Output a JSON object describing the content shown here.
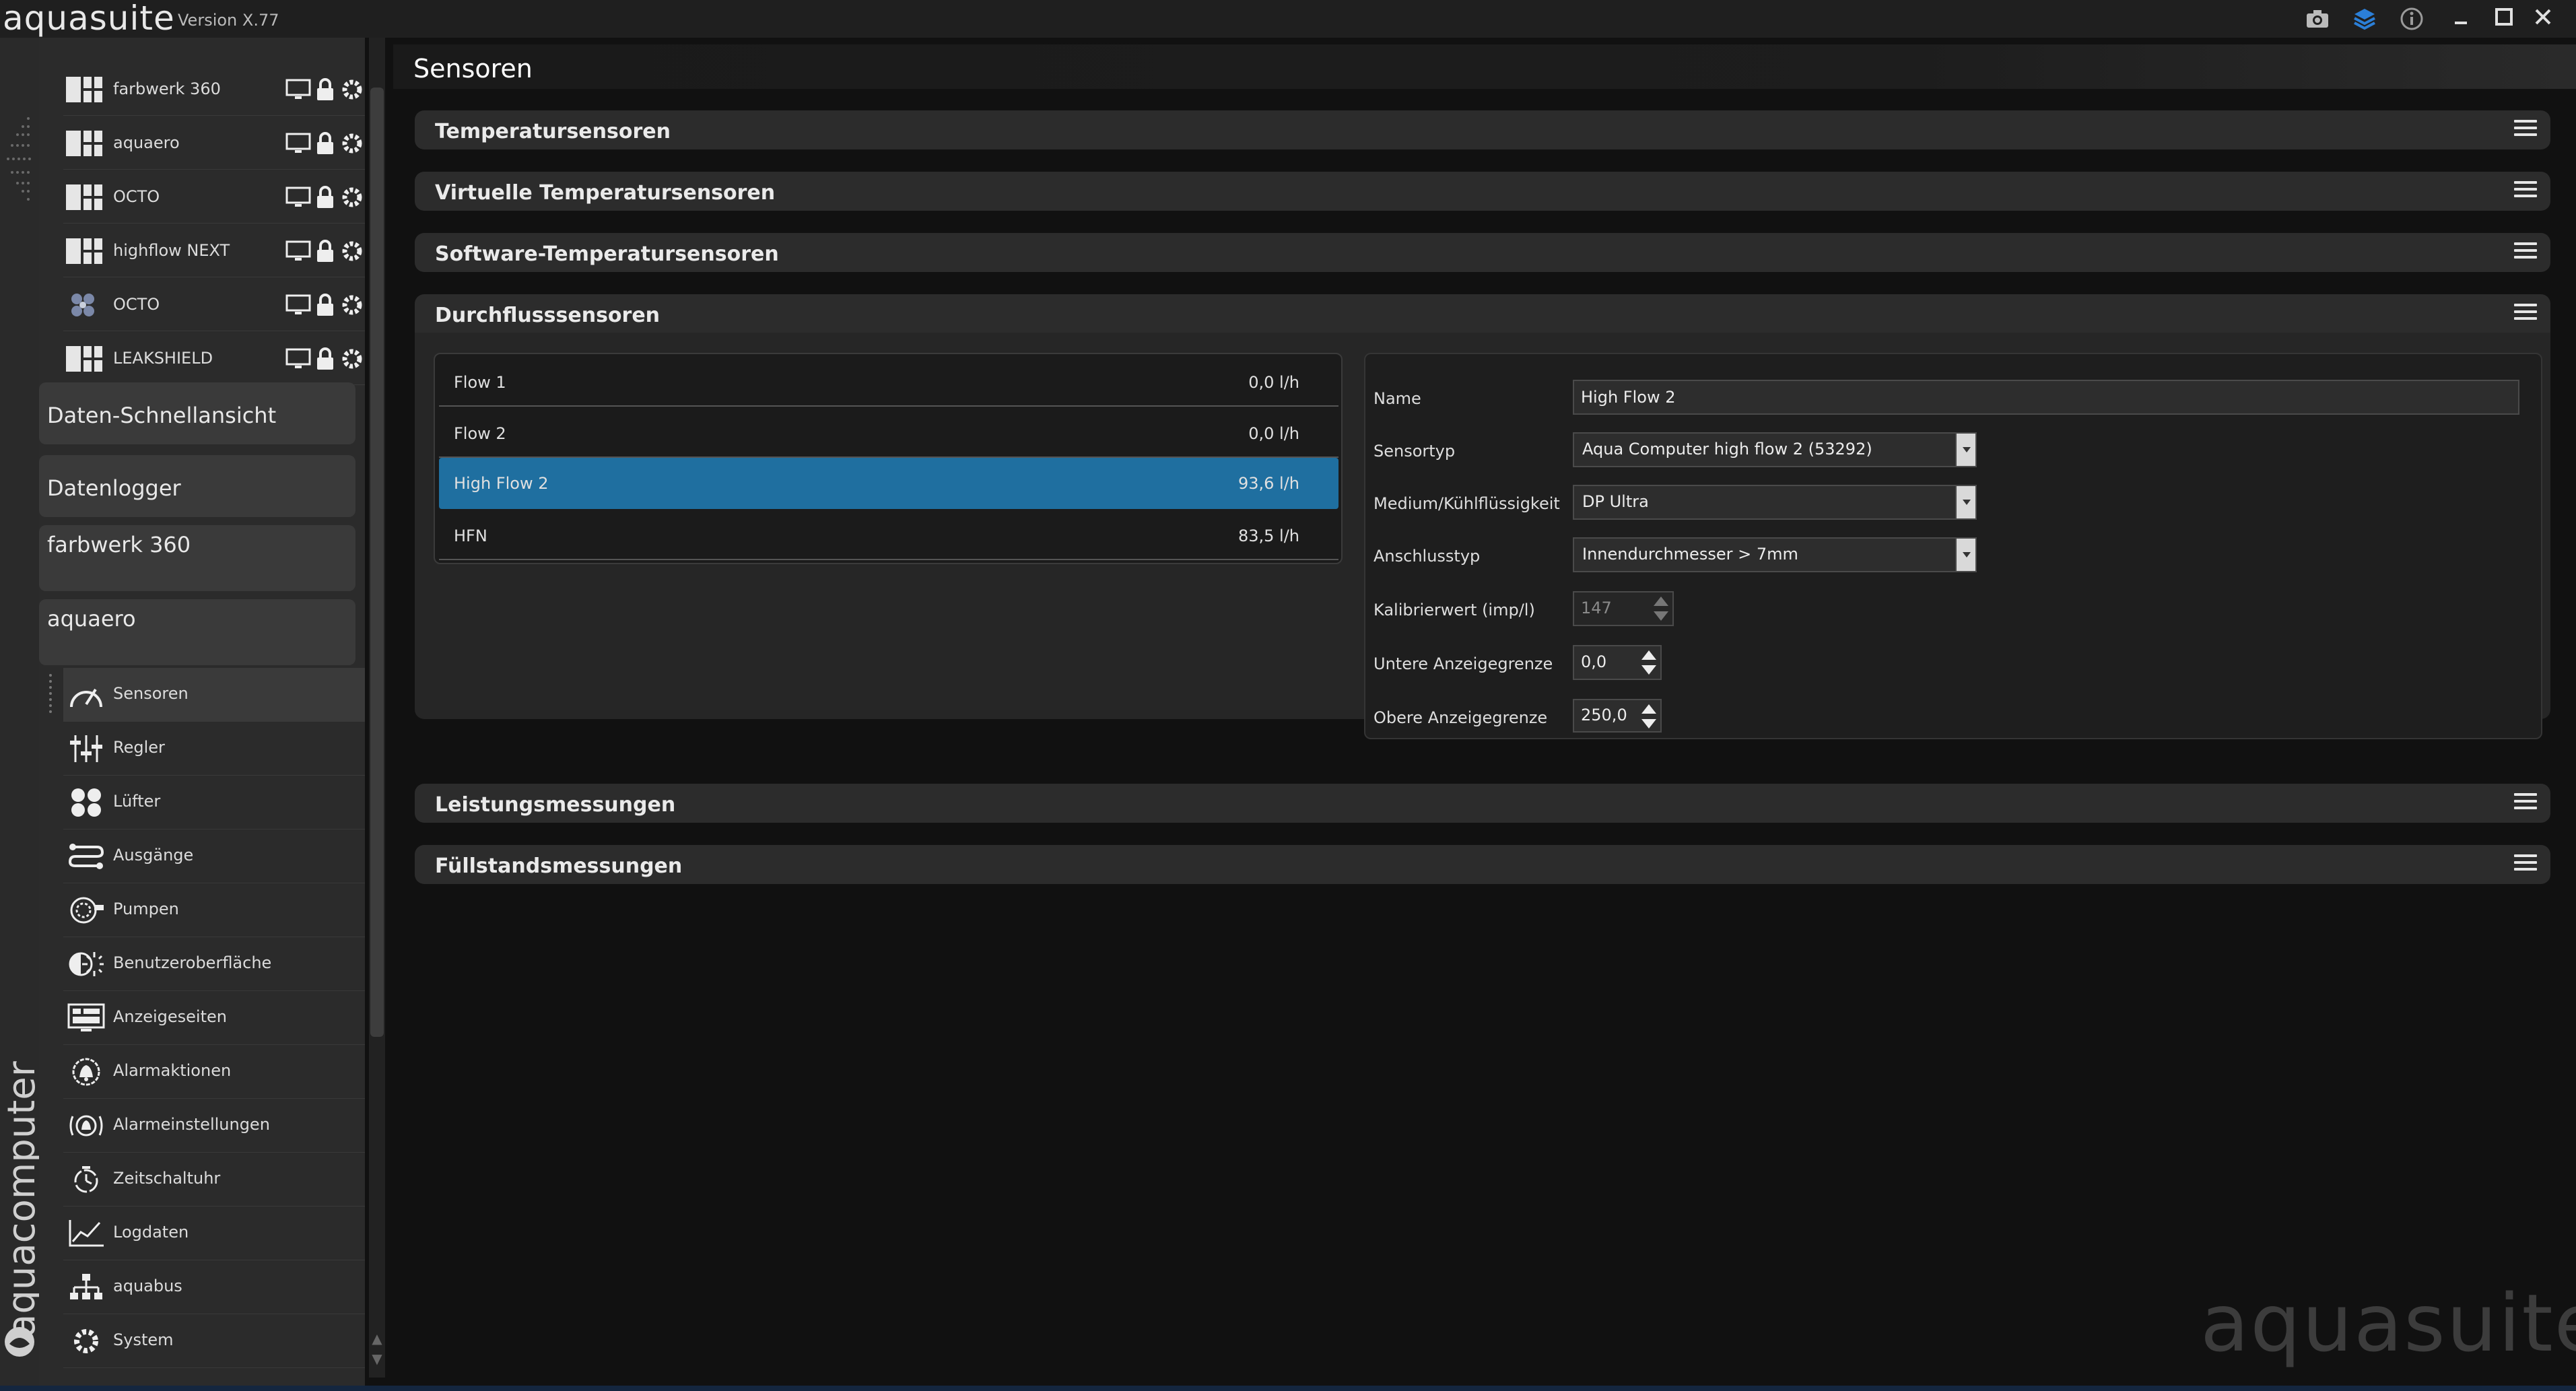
{
  "titlebar": {
    "app_name": "aquasuite",
    "version": "Version X.77"
  },
  "brand": {
    "vertical_text": "aquacomputer",
    "watermark": "aquasuite"
  },
  "sidebar": {
    "devices": [
      {
        "label": "farbwerk 360",
        "icon": "device-grid-icon"
      },
      {
        "label": "aquaero",
        "icon": "device-grid-icon"
      },
      {
        "label": "OCTO",
        "icon": "device-grid-icon"
      },
      {
        "label": "highflow NEXT",
        "icon": "device-grid-icon"
      },
      {
        "label": "OCTO",
        "icon": "device-fan-icon"
      },
      {
        "label": "LEAKSHIELD",
        "icon": "device-grid-icon"
      }
    ],
    "sections": {
      "quick_view": "Daten-Schnellansicht",
      "datalogger": "Datenlogger",
      "farbwerk": "farbwerk 360",
      "aquaero": "aquaero"
    },
    "menu": [
      {
        "label": "Sensoren",
        "icon": "gauge-icon",
        "active": true
      },
      {
        "label": "Regler",
        "icon": "sliders-icon"
      },
      {
        "label": "Lüfter",
        "icon": "fan-icon"
      },
      {
        "label": "Ausgänge",
        "icon": "outputs-icon"
      },
      {
        "label": "Pumpen",
        "icon": "pump-icon"
      },
      {
        "label": "Benutzeroberfläche",
        "icon": "brightness-icon"
      },
      {
        "label": "Anzeigeseiten",
        "icon": "display-pages-icon"
      },
      {
        "label": "Alarmaktionen",
        "icon": "alarm-bell-icon"
      },
      {
        "label": "Alarmeinstellungen",
        "icon": "alarm-settings-icon"
      },
      {
        "label": "Zeitschaltuhr",
        "icon": "timer-icon"
      },
      {
        "label": "Logdaten",
        "icon": "chart-line-icon"
      },
      {
        "label": "aquabus",
        "icon": "network-icon"
      },
      {
        "label": "System",
        "icon": "gear-icon"
      }
    ]
  },
  "main": {
    "title": "Sensoren",
    "accordions": {
      "temp": "Temperatursensoren",
      "virtual": "Virtuelle Temperatursensoren",
      "software": "Software-Temperatursensoren",
      "flow": "Durchflusssensoren",
      "power": "Leistungsmessungen",
      "level": "Füllstandsmessungen"
    },
    "flow_list": [
      {
        "name": "Flow 1",
        "value": "0,0 l/h",
        "selected": false
      },
      {
        "name": "Flow 2",
        "value": "0,0 l/h",
        "selected": false
      },
      {
        "name": "High Flow 2",
        "value": "93,6 l/h",
        "selected": true
      },
      {
        "name": "HFN",
        "value": "83,5 l/h",
        "selected": false
      }
    ],
    "detail": {
      "name_label": "Name",
      "name_value": "High Flow 2",
      "sensortype_label": "Sensortyp",
      "sensortype_value": "Aqua Computer high flow 2 (53292)",
      "medium_label": "Medium/Kühlflüssigkeit",
      "medium_value": "DP Ultra",
      "connection_label": "Anschlusstyp",
      "connection_value": "Innendurchmesser > 7mm",
      "calibration_label": "Kalibrierwert (imp/l)",
      "calibration_value": "147",
      "lower_label": "Untere Anzeigegrenze",
      "lower_value": "0,0",
      "upper_label": "Obere Anzeigegrenze",
      "upper_value": "250,0"
    }
  },
  "colors": {
    "selection": "#1f6fa0",
    "accent_blue": "#2b7fd8"
  }
}
